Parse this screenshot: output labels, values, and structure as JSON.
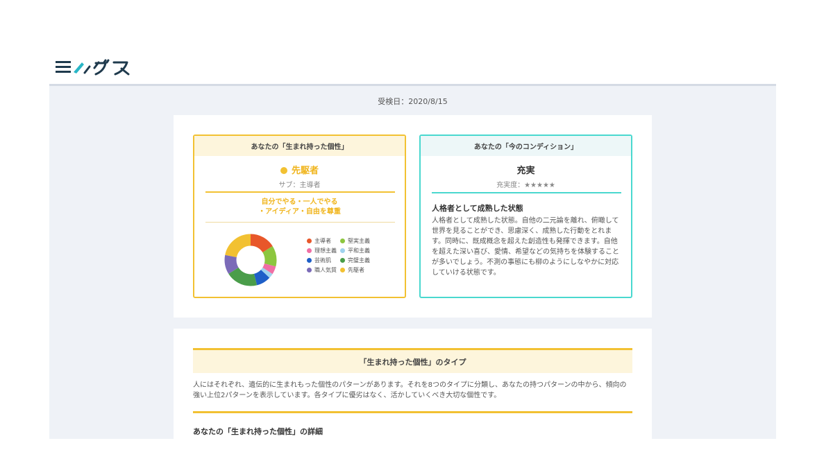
{
  "brand": {
    "name": "ミイダス"
  },
  "exam_date": "受検日：2020/8/15",
  "personality_panel": {
    "header": "あなたの「生まれ持った個性」",
    "type_name": "先駆者",
    "sub_type": "サブ：主導者",
    "slogan_line1": "自分でやる・一人でやる",
    "slogan_line2": "・アイディア・自由を尊重",
    "chart_data": {
      "type": "pie",
      "categories": [
        "主導者",
        "堅実主義",
        "理想主義",
        "平和主義",
        "芸術肌",
        "完璧主義",
        "職人気質",
        "先駆者"
      ],
      "values": [
        16,
        13,
        5,
        3,
        9,
        20,
        12,
        22
      ],
      "colors": [
        "#e8572a",
        "#8cc63f",
        "#f06fa4",
        "#9fd3ef",
        "#1e5fc8",
        "#4a9d4a",
        "#7b6bb8",
        "#f2c132"
      ]
    },
    "legend": [
      {
        "label": "主導者",
        "color": "#e8572a"
      },
      {
        "label": "堅実主義",
        "color": "#8cc63f"
      },
      {
        "label": "理想主義",
        "color": "#f06fa4"
      },
      {
        "label": "平和主義",
        "color": "#9fd3ef"
      },
      {
        "label": "芸術肌",
        "color": "#1e5fc8"
      },
      {
        "label": "完璧主義",
        "color": "#4a9d4a"
      },
      {
        "label": "職人気質",
        "color": "#7b6bb8"
      },
      {
        "label": "先駆者",
        "color": "#f2c132"
      }
    ]
  },
  "condition_panel": {
    "header": "あなたの「今のコンディション」",
    "title": "充実",
    "stars": "充実度：★★★★★",
    "heading": "人格者として成熟した状態",
    "body": "人格者として成熟した状態。自他の二元論を離れ、俯瞰して世界を見ることができ、思慮深く、成熟した行動をとれます。同時に、既成概念を超えた創造性も発揮できます。自他を超えた深い喜び、愛情、希望などの気持ちを体験することが多いでしょう。不測の事態にも柳のようにしなやかに対応していける状態です。"
  },
  "type_section": {
    "title": "「生まれ持った個性」のタイプ",
    "description": "人にはそれぞれ、遺伝的に生まれもった個性のパターンがあります。それを8つのタイプに分類し、あなたの持つパターンの中から、傾向の強い上位2パターンを表示しています。各タイプに優劣はなく、活かしていくべき大切な個性です。",
    "detail_heading": "あなたの「生まれ持った個性」の詳細"
  }
}
